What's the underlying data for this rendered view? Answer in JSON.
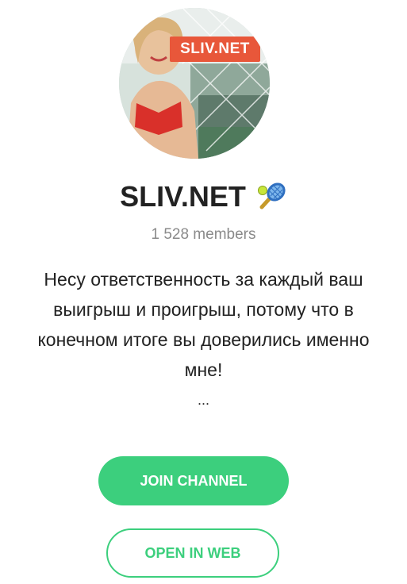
{
  "channel": {
    "avatar_logo_text": "SLIV.NET",
    "title": "SLIV.NET",
    "title_icon": "tennis-racket-icon",
    "members": "1 528 members",
    "description_lines": [
      "Несу ответственность за каждый ваш",
      "выигрыш и проигрыш, потому что в",
      "конечном итоге вы доверились именно",
      "мне!"
    ],
    "ellipsis": "..."
  },
  "buttons": {
    "join_label": "JOIN CHANNEL",
    "web_label": "OPEN IN WEB"
  },
  "colors": {
    "accent": "#3ccf7d",
    "logo_badge": "#e8573a",
    "title_text": "#222222",
    "muted_text": "#8a8a8a"
  }
}
